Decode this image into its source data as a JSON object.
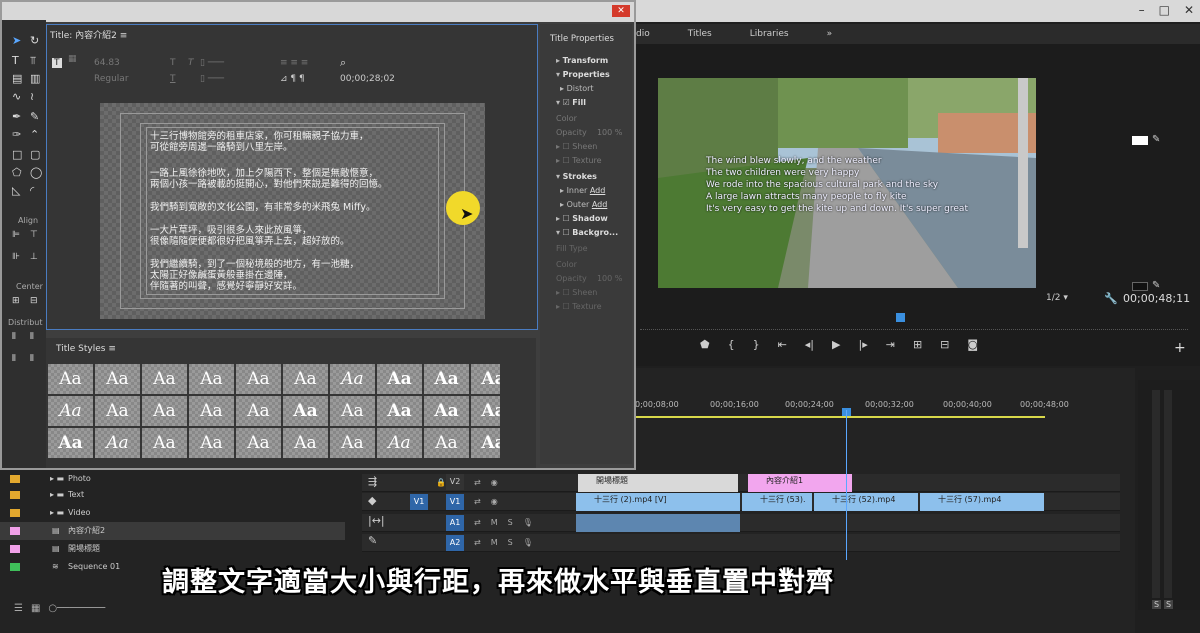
{
  "browser_tabs": [
    "dio",
    "Titles",
    "Libraries"
  ],
  "program": {
    "zoom": "1/2",
    "timecode": "00;00;48;11",
    "captions": [
      "The wind blew slowly, and the weather",
      "The two children were very happy",
      "We rode into the spacious cultural park and the sky",
      "A large lawn attracts many people to fly kite",
      "It's very easy to get the kite up and down. It's super great"
    ]
  },
  "timeline": {
    "ruler": [
      "0;00;08;00",
      "00;00;16;00",
      "00;00;24;00",
      "00;00;32;00",
      "00;00;40;00",
      "00;00;48;00"
    ],
    "tracks": [
      {
        "src": "",
        "name": "V2"
      },
      {
        "src": "V1",
        "name": "V1"
      },
      {
        "src": "",
        "name": "A1"
      },
      {
        "src": "",
        "name": "A2"
      }
    ],
    "v2_clips": [
      "開場標題",
      "內容介紹1"
    ],
    "v1_clips": [
      "十三行 (2).mp4 [V]",
      "十三行 (53).",
      "十三行 (52).mp4",
      "十三行 (57).mp4"
    ],
    "track_btns": [
      "M",
      "S"
    ]
  },
  "project": {
    "items": [
      {
        "label": "Photo",
        "color": "#e2a82e"
      },
      {
        "label": "Text",
        "color": "#e2a82e"
      },
      {
        "label": "Video",
        "color": "#e2a82e"
      },
      {
        "label": "內容介紹2",
        "color": "#f0a0e8"
      },
      {
        "label": "開場標題",
        "color": "#f0a0e8"
      },
      {
        "label": "Sequence 01",
        "color": "#3fbf5a"
      }
    ]
  },
  "title_window": {
    "tab": "Title: 內容介紹2",
    "toolbar": {
      "font_size": "64.83",
      "style": "Regular",
      "timecode": "00;00;28;02"
    },
    "tools_labels": {
      "align": "Align",
      "center": "Center",
      "distribute": "Distribut"
    },
    "canvas_lines": [
      "十三行博物館旁的租車店家，你可租輛親子協力車，",
      "可從館旁周邊一路騎到八里左岸。",
      "",
      "一路上風徐徐地吹，加上夕陽西下，整個是無敵愜意，",
      "兩個小孩一路被載的挺開心，對他們來說是難得的回憶。",
      "",
      "我們騎到寬敞的文化公園，有非常多的米飛兔 Miffy。",
      "",
      "一大片草坪，吸引很多人來此放風箏，",
      "很像隨隨便便都很好把風箏弄上去，超好放的。",
      "",
      "我們繼續騎，到了一個秘境般的地方，有一池糖，",
      "太陽正好像鹹蛋黃般垂掛在邊陲，",
      "伴隨著的叫聲，感覺好寧靜好安詳。"
    ],
    "styles_header": "Title Styles",
    "styles": [
      "Aa",
      "Aa",
      "Aa",
      "Aa",
      "Aa",
      "Aa",
      "Aa",
      "Aa",
      "Aa",
      "Aa",
      "Aa",
      "Aa",
      "Aa",
      "Aa",
      "Aa",
      "Aa",
      "Aa",
      "Aa",
      "Aa",
      "Aa",
      "Aa",
      "Aa",
      "Aa",
      "Aa",
      "Aa",
      "Aa",
      "Aa",
      "Aa",
      "Aa",
      "Aa"
    ],
    "properties": {
      "header": "Title Properties",
      "transform": "Transform",
      "properties": "Properties",
      "distort": "Distort",
      "fill": "Fill",
      "color": "Color",
      "opacity": "Opacity",
      "opacity_val": "100 %",
      "sheen": "Sheen",
      "texture": "Texture",
      "strokes": "Strokes",
      "inner": "Inner",
      "outer": "Outer",
      "add": "Add",
      "shadow": "Shadow",
      "background": "Backgro...",
      "fill_type": "Fill Type"
    }
  },
  "subtitle": "調整文字適當大小與行距，再來做水平與垂直置中對齊"
}
